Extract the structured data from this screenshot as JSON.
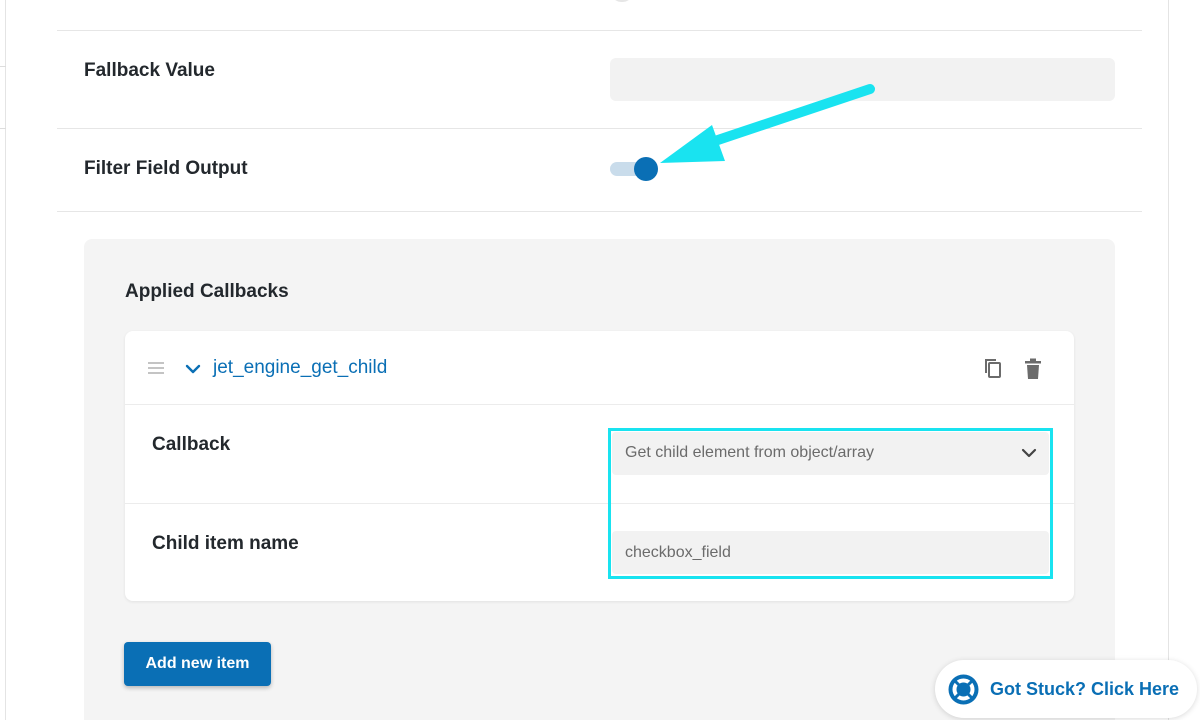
{
  "settings": {
    "fallback_label": "Fallback Value",
    "fallback_value": "",
    "filter_label": "Filter Field Output",
    "filter_enabled": true
  },
  "callbacks": {
    "title": "Applied Callbacks",
    "items": [
      {
        "title": "jet_engine_get_child",
        "callback_label": "Callback",
        "callback_value": "Get child element from object/array",
        "child_label": "Child item name",
        "child_value": "checkbox_field"
      }
    ],
    "add_label": "Add new item"
  },
  "help": {
    "label": "Got Stuck? Click Here"
  },
  "colors": {
    "accent": "#0a6fb5",
    "annotation": "#19e3f0",
    "panel_bg": "#f4f4f4",
    "input_bg": "#f2f2f2"
  },
  "icons": {
    "drag": "drag-handle-icon",
    "expand": "chevron-down-icon",
    "copy": "copy-icon",
    "delete": "trash-icon",
    "help": "lifebuoy-icon"
  }
}
